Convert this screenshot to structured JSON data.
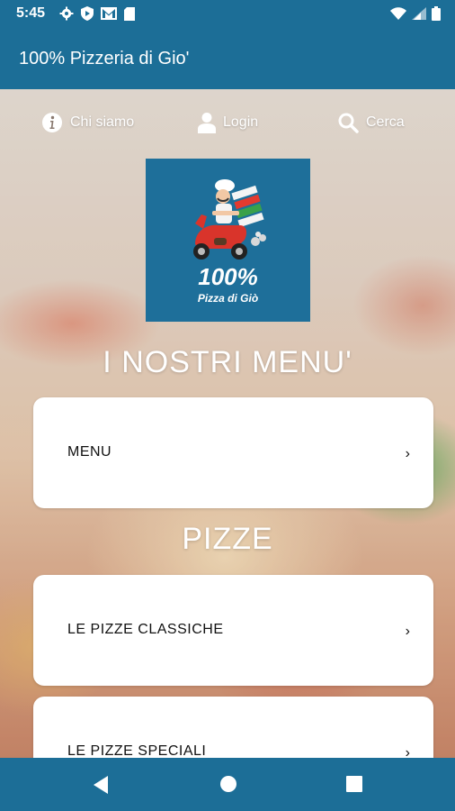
{
  "status_bar": {
    "time": "5:45",
    "left_icons": [
      "gear-icon",
      "shield-icon",
      "gmail-icon",
      "sd-card-icon"
    ],
    "right_icons": [
      "wifi-icon",
      "signal-icon",
      "battery-icon"
    ]
  },
  "app_bar": {
    "title": "100% Pizzeria di Gio'"
  },
  "top_nav": {
    "items": [
      {
        "label": "Chi siamo",
        "icon": "info-icon"
      },
      {
        "label": "Login",
        "icon": "user-icon"
      },
      {
        "label": "Cerca",
        "icon": "search-icon"
      }
    ]
  },
  "logo": {
    "line1": "100%",
    "line2": "Pizza di Giò"
  },
  "sections": [
    {
      "title": "I NOSTRI MENU'",
      "items": [
        {
          "label": "MENU"
        }
      ]
    },
    {
      "title": "PIZZE",
      "items": [
        {
          "label": "LE PIZZE CLASSICHE"
        },
        {
          "label": "LE PIZZE SPECIALI"
        }
      ]
    }
  ],
  "chevron": "›",
  "colors": {
    "brand": "#1c6e97",
    "card": "#ffffff"
  }
}
